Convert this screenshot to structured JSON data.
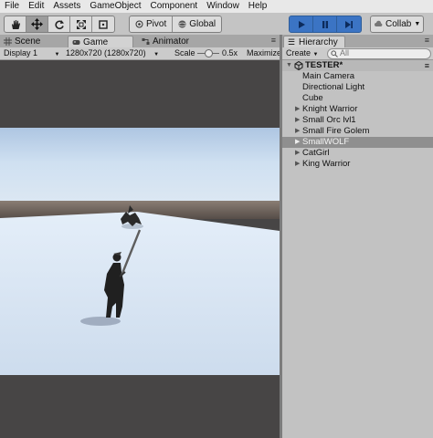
{
  "menu": [
    "File",
    "Edit",
    "Assets",
    "GameObject",
    "Component",
    "Window",
    "Help"
  ],
  "toolbar": {
    "tools": [
      "hand-icon",
      "move-icon",
      "rotate-icon",
      "scale-icon",
      "rect-icon"
    ],
    "pivot_label": "Pivot",
    "global_label": "Global",
    "collab_label": "Collab",
    "play_controls": [
      "play-icon",
      "pause-icon",
      "step-icon"
    ]
  },
  "tabs": {
    "scene": "Scene",
    "game": "Game",
    "animator": "Animator"
  },
  "game_toolbar": {
    "display": "Display 1",
    "resolution": "1280x720 (1280x720)",
    "scale_label": "Scale",
    "scale_value": "0.5x",
    "maximize_label": "Maximize"
  },
  "hierarchy": {
    "title": "Hierarchy",
    "create_label": "Create",
    "search_placeholder": "All",
    "scene_name": "TESTER*",
    "items": [
      {
        "label": "Main Camera",
        "expandable": false,
        "selected": false
      },
      {
        "label": "Directional Light",
        "expandable": false,
        "selected": false
      },
      {
        "label": "Cube",
        "expandable": false,
        "selected": false
      },
      {
        "label": "Knight Warrior",
        "expandable": true,
        "selected": false
      },
      {
        "label": "Small Orc lvl1",
        "expandable": true,
        "selected": false
      },
      {
        "label": "Small Fire Golem",
        "expandable": true,
        "selected": false
      },
      {
        "label": "SmallWOLF",
        "expandable": true,
        "selected": true
      },
      {
        "label": "CatGirl",
        "expandable": true,
        "selected": false
      },
      {
        "label": "King Warrior",
        "expandable": true,
        "selected": false
      }
    ]
  },
  "colors": {
    "play_active": "#3b74c4",
    "selected_row": "#8f8f8f",
    "sky": "#c8dcef",
    "ground": "#e6eef8"
  }
}
